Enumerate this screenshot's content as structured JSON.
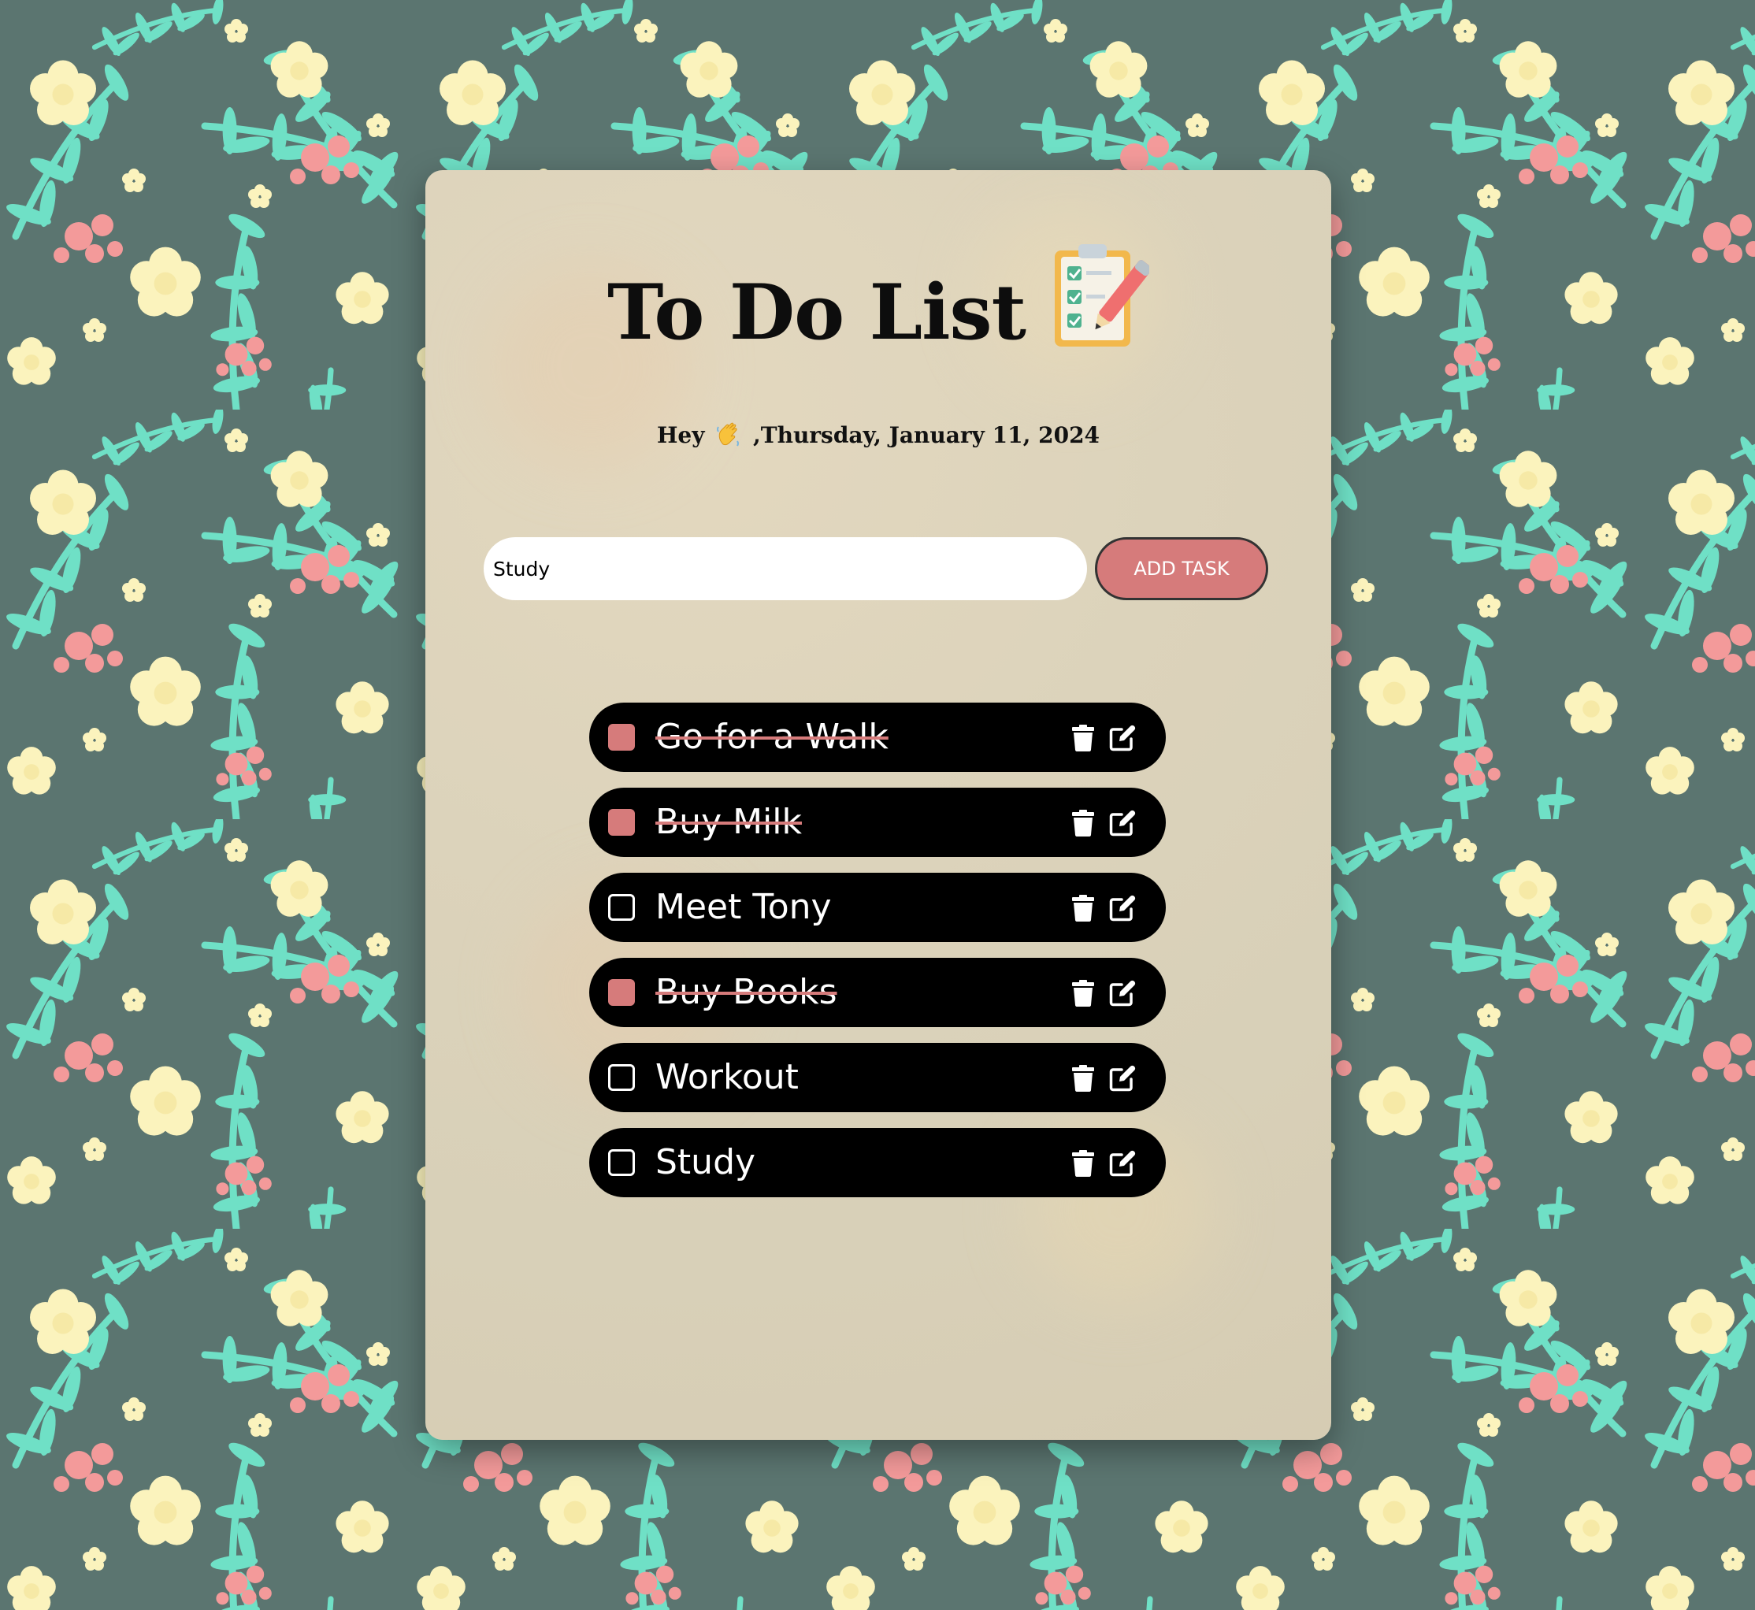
{
  "app": {
    "title": "To Do List",
    "title_icon": "clipboard-checklist-pencil-icon",
    "greeting_prefix": "Hey",
    "greeting_icon": "waving-hand-icon",
    "greeting_suffix": ",Thursday, January 11, 2024"
  },
  "input": {
    "value": "Study",
    "placeholder": ""
  },
  "add_button": {
    "label": "ADD TASK"
  },
  "tasks": [
    {
      "text": "Go for a Walk",
      "completed": true
    },
    {
      "text": "Buy Milk",
      "completed": true
    },
    {
      "text": "Meet Tony",
      "completed": false
    },
    {
      "text": "Buy Books",
      "completed": true
    },
    {
      "text": "Workout",
      "completed": false
    },
    {
      "text": "Study",
      "completed": false
    }
  ],
  "task_actions": {
    "delete_icon": "trash-icon",
    "edit_icon": "edit-icon"
  },
  "colors": {
    "background": "#5b7570",
    "leaf": "#6fe0c6",
    "flower": "#fbf3bd",
    "berry": "#f39a9a",
    "accent": "#d67b7b",
    "task_bg": "#000000",
    "card": "#dcd3bb"
  }
}
